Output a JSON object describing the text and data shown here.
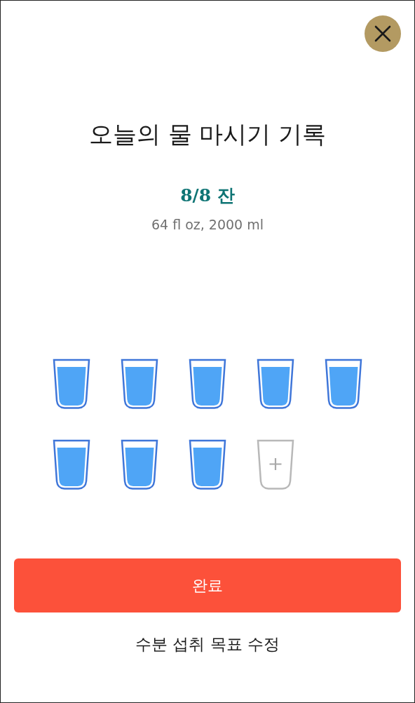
{
  "title": "오늘의 물 마시기 기록",
  "count": "8/8 잔",
  "volume": "64 fl oz, 2000 ml",
  "glasses": [
    {
      "filled": true
    },
    {
      "filled": true
    },
    {
      "filled": true
    },
    {
      "filled": true
    },
    {
      "filled": true
    },
    {
      "filled": true
    },
    {
      "filled": true
    },
    {
      "filled": true
    },
    {
      "filled": false
    }
  ],
  "done_button": "완료",
  "edit_goal_link": "수분 섭취 목표 수정"
}
